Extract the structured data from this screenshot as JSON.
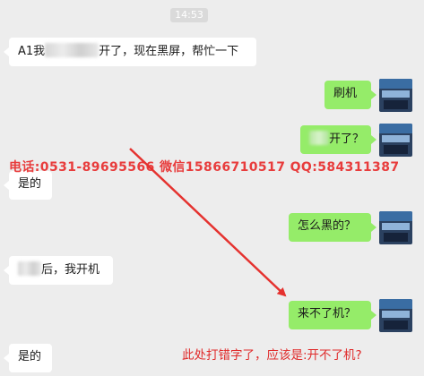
{
  "chat": {
    "timestamp": "14:53",
    "messages": [
      {
        "side": "in",
        "before": "A1我",
        "after": "开了，现在黑屏，帮忙一下"
      },
      {
        "side": "out",
        "text": "刷机"
      },
      {
        "side": "out",
        "before": "",
        "after": "开了？"
      },
      {
        "side": "in",
        "text": "是的"
      },
      {
        "side": "out",
        "text": "怎么黑的？"
      },
      {
        "side": "in",
        "before": "",
        "after": "后，我开机"
      },
      {
        "side": "out",
        "text": "来不了机？"
      },
      {
        "side": "in",
        "text": "是的"
      }
    ]
  },
  "overlay": {
    "watermark": "电话:0531-89695566 微信15866710517 QQ:584311387",
    "annotation": "此处打错字了，应该是:开不了机?",
    "annotation_color": "#e02a2a",
    "arrow_color": "#e5322f"
  },
  "colors": {
    "background": "#ededed",
    "incoming_bubble": "#ffffff",
    "outgoing_bubble": "#95ec69"
  }
}
